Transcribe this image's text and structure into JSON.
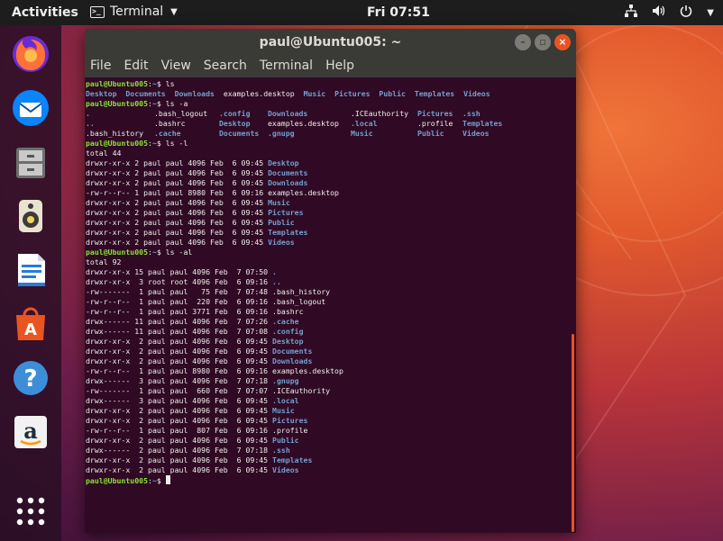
{
  "topbar": {
    "activities": "Activities",
    "app_name": "Terminal",
    "clock": "Fri 07:51",
    "icons": [
      "network-icon",
      "volume-icon",
      "power-icon",
      "chevron-down-icon"
    ]
  },
  "dock": {
    "items": [
      {
        "name": "firefox",
        "icon": "firefox-icon",
        "color": "#ff7139"
      },
      {
        "name": "thunderbird",
        "icon": "thunderbird-icon",
        "color": "#0a84ff"
      },
      {
        "name": "files",
        "icon": "files-icon",
        "color": "#8a8a8a"
      },
      {
        "name": "rhythmbox",
        "icon": "rhythmbox-icon",
        "color": "#f4d35e"
      },
      {
        "name": "libreoffice-writer",
        "icon": "writer-icon",
        "color": "#2a7bd6"
      },
      {
        "name": "software",
        "icon": "software-icon",
        "color": "#e95420"
      },
      {
        "name": "help",
        "icon": "help-icon",
        "color": "#3d8ed8"
      },
      {
        "name": "amazon",
        "icon": "amazon-icon",
        "color": "#ffffff"
      },
      {
        "name": "show-applications",
        "icon": "apps-grid-icon",
        "color": "#ffffff"
      }
    ]
  },
  "window": {
    "title": "paul@Ubuntu005: ~",
    "menu": [
      "File",
      "Edit",
      "View",
      "Search",
      "Terminal",
      "Help"
    ]
  },
  "terminal": {
    "user": "paul@Ubuntu005",
    "dir": "~",
    "lines": [
      {
        "t": "prompt",
        "cmd": "ls"
      },
      {
        "t": "cols",
        "cells": [
          [
            "Desktop",
            "d"
          ],
          [
            "Documents",
            "d"
          ],
          [
            "Downloads",
            "d"
          ],
          [
            "examples.desktop",
            ""
          ],
          [
            "Music",
            "d"
          ],
          [
            "Pictures",
            "d"
          ],
          [
            "Public",
            "d"
          ],
          [
            "Templates",
            "d"
          ],
          [
            "Videos",
            "d"
          ]
        ]
      },
      {
        "t": "prompt",
        "cmd": "ls -a"
      },
      {
        "t": "grid",
        "cells": [
          [
            ".",
            "d"
          ],
          [
            ".bash_logout",
            ""
          ],
          [
            ".config",
            "d"
          ],
          [
            "Downloads",
            "d"
          ],
          [
            ".ICEauthority",
            ""
          ],
          [
            "Pictures",
            "d"
          ],
          [
            ".ssh",
            "d"
          ]
        ]
      },
      {
        "t": "grid",
        "cells": [
          [
            "..",
            "d"
          ],
          [
            ".bashrc",
            ""
          ],
          [
            "Desktop",
            "d"
          ],
          [
            "examples.desktop",
            ""
          ],
          [
            ".local",
            "d"
          ],
          [
            ".profile",
            ""
          ],
          [
            "Templates",
            "d"
          ]
        ]
      },
      {
        "t": "grid",
        "cells": [
          [
            ".bash_history",
            ""
          ],
          [
            ".cache",
            "d"
          ],
          [
            "Documents",
            "d"
          ],
          [
            ".gnupg",
            "d"
          ],
          [
            "Music",
            "d"
          ],
          [
            "Public",
            "d"
          ],
          [
            "Videos",
            "d"
          ]
        ]
      },
      {
        "t": "prompt",
        "cmd": "ls -l"
      },
      {
        "t": "text",
        "text": "total 44"
      },
      {
        "t": "long",
        "meta": "drwxr-xr-x 2 paul paul 4096 Feb  6 09:45 ",
        "name": "Desktop",
        "d": true
      },
      {
        "t": "long",
        "meta": "drwxr-xr-x 2 paul paul 4096 Feb  6 09:45 ",
        "name": "Documents",
        "d": true
      },
      {
        "t": "long",
        "meta": "drwxr-xr-x 2 paul paul 4096 Feb  6 09:45 ",
        "name": "Downloads",
        "d": true
      },
      {
        "t": "long",
        "meta": "-rw-r--r-- 1 paul paul 8980 Feb  6 09:16 ",
        "name": "examples.desktop",
        "d": false
      },
      {
        "t": "long",
        "meta": "drwxr-xr-x 2 paul paul 4096 Feb  6 09:45 ",
        "name": "Music",
        "d": true
      },
      {
        "t": "long",
        "meta": "drwxr-xr-x 2 paul paul 4096 Feb  6 09:45 ",
        "name": "Pictures",
        "d": true
      },
      {
        "t": "long",
        "meta": "drwxr-xr-x 2 paul paul 4096 Feb  6 09:45 ",
        "name": "Public",
        "d": true
      },
      {
        "t": "long",
        "meta": "drwxr-xr-x 2 paul paul 4096 Feb  6 09:45 ",
        "name": "Templates",
        "d": true
      },
      {
        "t": "long",
        "meta": "drwxr-xr-x 2 paul paul 4096 Feb  6 09:45 ",
        "name": "Videos",
        "d": true
      },
      {
        "t": "prompt",
        "cmd": "ls -al"
      },
      {
        "t": "text",
        "text": "total 92"
      },
      {
        "t": "long",
        "meta": "drwxr-xr-x 15 paul paul 4096 Feb  7 07:50 ",
        "name": ".",
        "d": true
      },
      {
        "t": "long",
        "meta": "drwxr-xr-x  3 root root 4096 Feb  6 09:16 ",
        "name": "..",
        "d": true
      },
      {
        "t": "long",
        "meta": "-rw-------  1 paul paul   75 Feb  7 07:48 ",
        "name": ".bash_history",
        "d": false
      },
      {
        "t": "long",
        "meta": "-rw-r--r--  1 paul paul  220 Feb  6 09:16 ",
        "name": ".bash_logout",
        "d": false
      },
      {
        "t": "long",
        "meta": "-rw-r--r--  1 paul paul 3771 Feb  6 09:16 ",
        "name": ".bashrc",
        "d": false
      },
      {
        "t": "long",
        "meta": "drwx------ 11 paul paul 4096 Feb  7 07:26 ",
        "name": ".cache",
        "d": true
      },
      {
        "t": "long",
        "meta": "drwx------ 11 paul paul 4096 Feb  7 07:08 ",
        "name": ".config",
        "d": true
      },
      {
        "t": "long",
        "meta": "drwxr-xr-x  2 paul paul 4096 Feb  6 09:45 ",
        "name": "Desktop",
        "d": true
      },
      {
        "t": "long",
        "meta": "drwxr-xr-x  2 paul paul 4096 Feb  6 09:45 ",
        "name": "Documents",
        "d": true
      },
      {
        "t": "long",
        "meta": "drwxr-xr-x  2 paul paul 4096 Feb  6 09:45 ",
        "name": "Downloads",
        "d": true
      },
      {
        "t": "long",
        "meta": "-rw-r--r--  1 paul paul 8980 Feb  6 09:16 ",
        "name": "examples.desktop",
        "d": false
      },
      {
        "t": "long",
        "meta": "drwx------  3 paul paul 4096 Feb  7 07:18 ",
        "name": ".gnupg",
        "d": true
      },
      {
        "t": "long",
        "meta": "-rw-------  1 paul paul  660 Feb  7 07:07 ",
        "name": ".ICEauthority",
        "d": false
      },
      {
        "t": "long",
        "meta": "drwx------  3 paul paul 4096 Feb  6 09:45 ",
        "name": ".local",
        "d": true
      },
      {
        "t": "long",
        "meta": "drwxr-xr-x  2 paul paul 4096 Feb  6 09:45 ",
        "name": "Music",
        "d": true
      },
      {
        "t": "long",
        "meta": "drwxr-xr-x  2 paul paul 4096 Feb  6 09:45 ",
        "name": "Pictures",
        "d": true
      },
      {
        "t": "long",
        "meta": "-rw-r--r--  1 paul paul  807 Feb  6 09:16 ",
        "name": ".profile",
        "d": false
      },
      {
        "t": "long",
        "meta": "drwxr-xr-x  2 paul paul 4096 Feb  6 09:45 ",
        "name": "Public",
        "d": true
      },
      {
        "t": "long",
        "meta": "drwx------  2 paul paul 4096 Feb  7 07:18 ",
        "name": ".ssh",
        "d": true
      },
      {
        "t": "long",
        "meta": "drwxr-xr-x  2 paul paul 4096 Feb  6 09:45 ",
        "name": "Templates",
        "d": true
      },
      {
        "t": "long",
        "meta": "drwxr-xr-x  2 paul paul 4096 Feb  6 09:45 ",
        "name": "Videos",
        "d": true
      },
      {
        "t": "prompt",
        "cmd": "",
        "cursor": true
      }
    ]
  },
  "colors": {
    "accent": "#e95420",
    "terminal_bg": "#300a24",
    "prompt_user": "#8ae234",
    "directory": "#729fcf"
  }
}
